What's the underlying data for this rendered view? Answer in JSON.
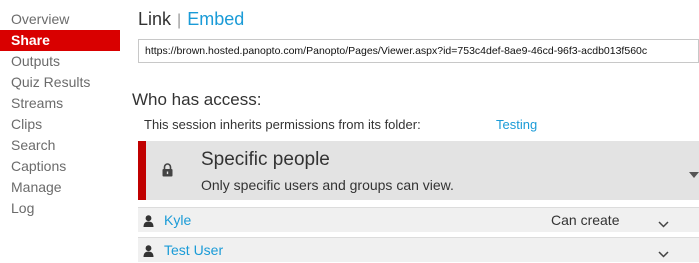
{
  "sidebar": {
    "items": [
      {
        "label": "Overview"
      },
      {
        "label": "Share"
      },
      {
        "label": "Outputs"
      },
      {
        "label": "Quiz Results"
      },
      {
        "label": "Streams"
      },
      {
        "label": "Clips"
      },
      {
        "label": "Search"
      },
      {
        "label": "Captions"
      },
      {
        "label": "Manage"
      },
      {
        "label": "Log"
      }
    ],
    "active": "Share"
  },
  "tabs": {
    "link": "Link",
    "separator": "|",
    "embed": "Embed"
  },
  "share_url": "https://brown.hosted.panopto.com/Panopto/Pages/Viewer.aspx?id=753c4def-8ae9-46cd-96f3-acdb013f560c",
  "access": {
    "title": "Who has access:",
    "inherit_text": "This session inherits permissions from its folder:",
    "folder_link": "Testing",
    "mode": {
      "title": "Specific people",
      "description": "Only specific users and groups can view.",
      "icon": "lock-icon"
    },
    "users": [
      {
        "name": "Kyle",
        "role": "Can create"
      },
      {
        "name": "Test User",
        "role": ""
      }
    ]
  },
  "colors": {
    "accent_red": "#d90000",
    "link_blue": "#1a9bd7",
    "panel_gray": "#e3e3e3"
  }
}
